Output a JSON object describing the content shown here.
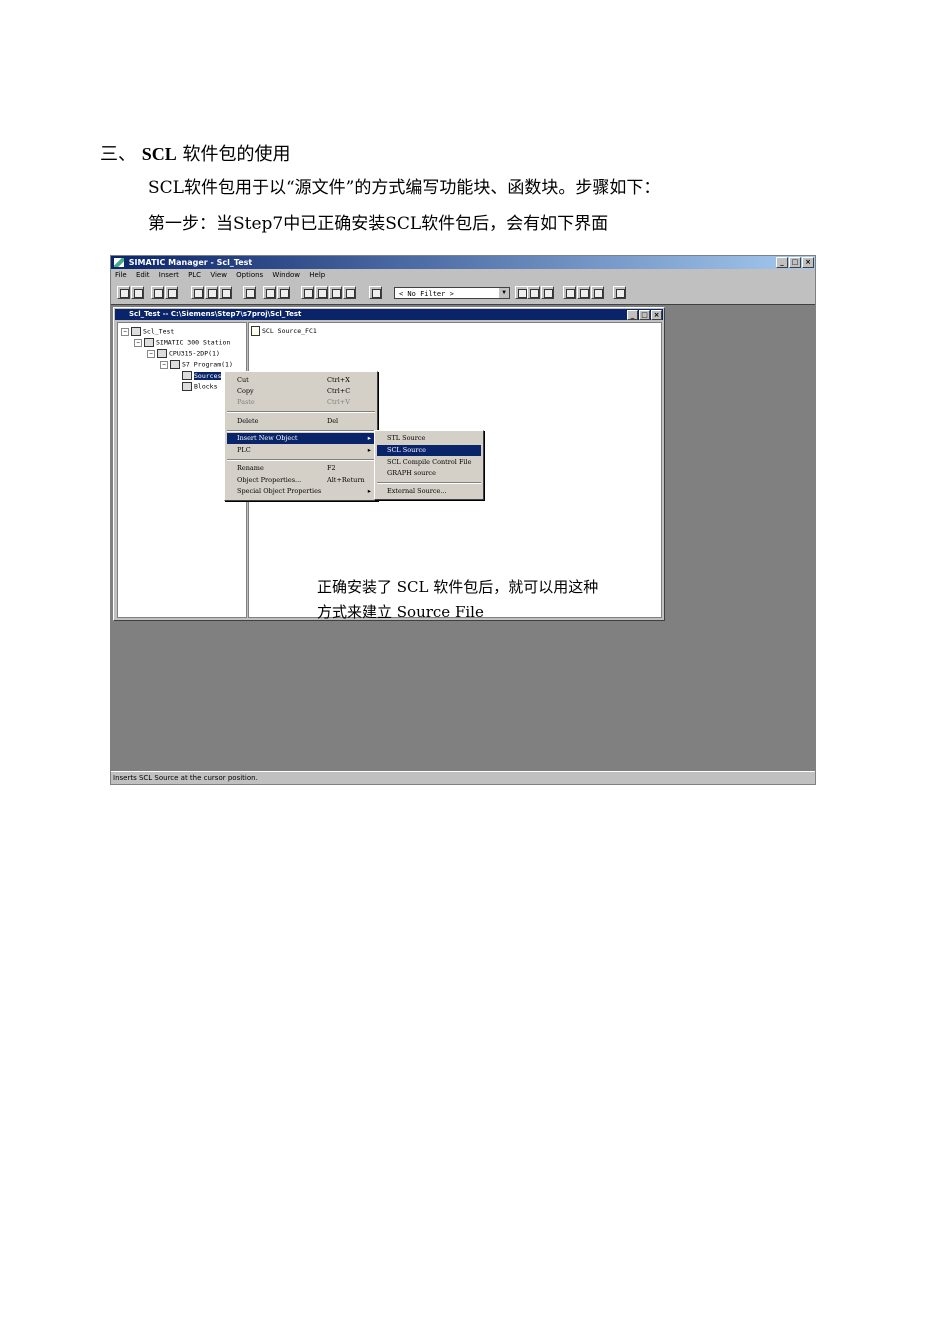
{
  "heading": {
    "number": "三、",
    "bold": "SCL",
    "rest": "软件包的使用"
  },
  "para1": "SCL软件包用于以“源文件”的方式编写功能块、函数块。步骤如下：",
  "para2": "第一步：当Step7中已正确安装SCL软件包后，会有如下界面",
  "app": {
    "title": "SIMATIC Manager - Scl_Test",
    "menu": [
      "File",
      "Edit",
      "Insert",
      "PLC",
      "View",
      "Options",
      "Window",
      "Help"
    ],
    "filter": "< No Filter >",
    "status": "Inserts SCL Source at the cursor position.",
    "child_title": "Scl_Test -- C:\\Siemens\\Step7\\s7proj\\Scl_Test",
    "tree": [
      "Scl_Test",
      "SIMATIC 300 Station",
      "CPU315-2DP(1)",
      "S7 Program(1)",
      "Sources",
      "Blocks"
    ],
    "right_item": "SCL Source_FC1",
    "caption_line1": "正确安装了 SCL 软件包后，就可以用这种",
    "caption_line2": "方式来建立 Source File"
  },
  "context_menu": {
    "cut": "Cut",
    "cut_sc": "Ctrl+X",
    "copy": "Copy",
    "copy_sc": "Ctrl+C",
    "paste": "Paste",
    "paste_sc": "Ctrl+V",
    "delete": "Delete",
    "delete_sc": "Del",
    "insert": "Insert New Object",
    "plc": "PLC",
    "rename": "Rename",
    "rename_sc": "F2",
    "props": "Object Properties...",
    "props_sc": "Alt+Return",
    "special": "Special Object Properties"
  },
  "submenu": {
    "stl": "STL Source",
    "scl": "SCL Source",
    "compile": "SCL Compile Control File",
    "graph": "GRAPH source",
    "external": "External Source..."
  }
}
